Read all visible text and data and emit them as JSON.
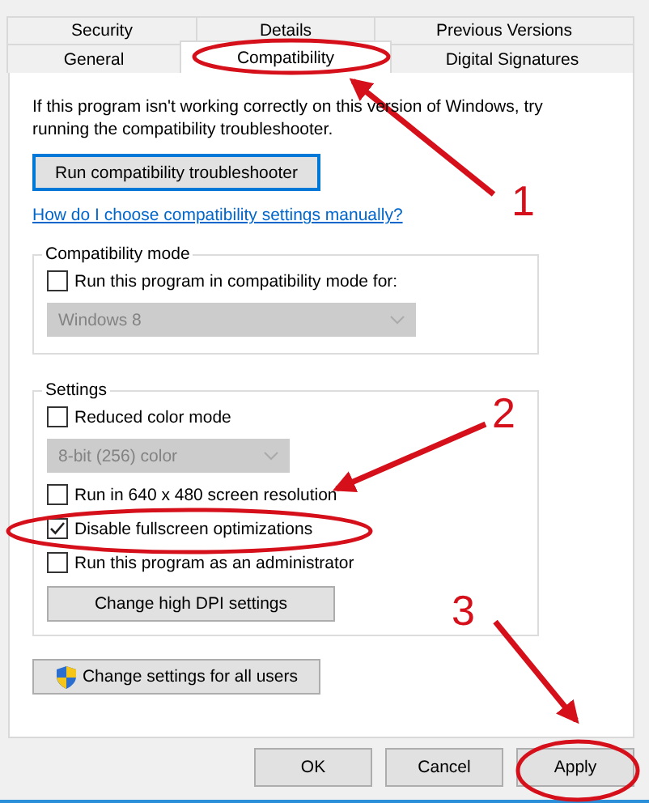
{
  "tab_rows": [
    [
      {
        "label": "Security",
        "selected": false
      },
      {
        "label": "Details",
        "selected": false
      },
      {
        "label": "Previous Versions",
        "selected": false
      }
    ],
    [
      {
        "label": "General",
        "selected": false
      },
      {
        "label": "Compatibility",
        "selected": true
      },
      {
        "label": "Digital Signatures",
        "selected": false
      }
    ]
  ],
  "description": "If this program isn't working correctly on this version of Windows, try running the compatibility troubleshooter.",
  "troubleshooter_button": "Run compatibility troubleshooter",
  "help_link": "How do I choose compatibility settings manually?",
  "compatibility_mode": {
    "title": "Compatibility mode",
    "items": [
      {
        "kind": "checkbox",
        "label": "Run this program in compatibility mode for:",
        "checked": false
      },
      {
        "kind": "dropdown",
        "value": "Windows 8",
        "disabled": true
      }
    ]
  },
  "settings": {
    "title": "Settings",
    "items": [
      {
        "kind": "checkbox",
        "label": "Reduced color mode",
        "checked": false
      },
      {
        "kind": "dropdown",
        "value": "8-bit (256) color",
        "disabled": true
      },
      {
        "kind": "checkbox",
        "label": "Run in 640 x 480 screen resolution",
        "checked": false
      },
      {
        "kind": "checkbox",
        "label": "Disable fullscreen optimizations",
        "checked": true
      },
      {
        "kind": "checkbox",
        "label": "Run this program as an administrator",
        "checked": false
      },
      {
        "kind": "button",
        "label": "Change high DPI settings"
      }
    ]
  },
  "all_users_button": "Change settings for all users",
  "buttons": [
    {
      "label": "OK"
    },
    {
      "label": "Cancel"
    },
    {
      "label": "Apply"
    }
  ],
  "annotations": [
    {
      "number": "1"
    },
    {
      "number": "2"
    },
    {
      "number": "3"
    }
  ]
}
